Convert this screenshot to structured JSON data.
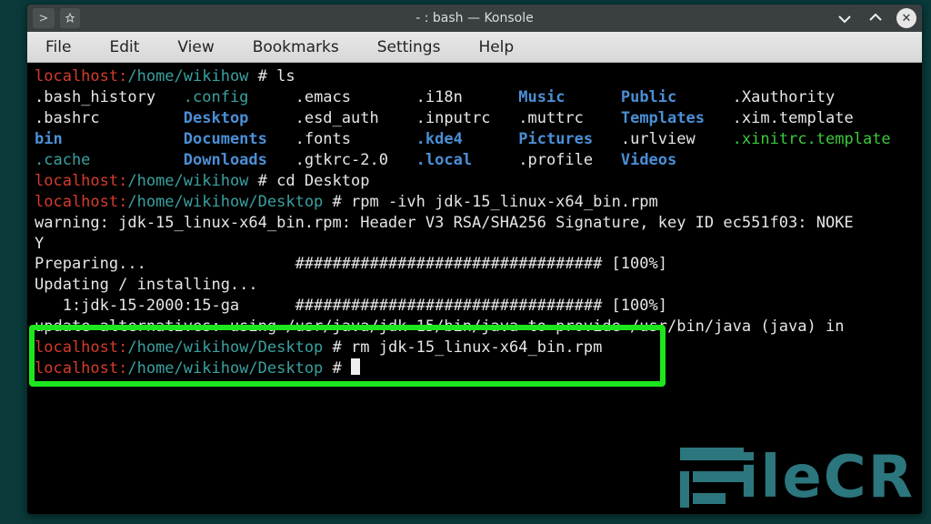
{
  "title": "- : bash — Konsole",
  "menus": {
    "file": "File",
    "edit": "Edit",
    "view": "View",
    "bookmarks": "Bookmarks",
    "settings": "Settings",
    "help": "Help"
  },
  "prompt1": {
    "user": "localhost:",
    "path": "/home/wikihow",
    "hash": " # "
  },
  "prompt2": {
    "user": "localhost:",
    "path": "/home/wikihow/Desktop",
    "hash": " # "
  },
  "cmds": {
    "ls": "ls",
    "cd": "cd Desktop",
    "rpm": "rpm -ivh jdk-15_linux-x64_bin.rpm",
    "rm": "rm jdk-15_linux-x64_bin.rpm"
  },
  "ls_rows": [
    [
      ".bash_history",
      ".config",
      ".emacs",
      ".i18n",
      "Music",
      "Public",
      ".Xauthority"
    ],
    [
      ".bashrc",
      "Desktop",
      ".esd_auth",
      ".inputrc",
      ".muttrc",
      "Templates",
      ".xim.template"
    ],
    [
      "bin",
      "Documents",
      ".fonts",
      ".kde4",
      "Pictures",
      ".urlview",
      ".xinitrc.template"
    ],
    [
      ".cache",
      "Downloads",
      ".gtkrc-2.0",
      ".local",
      ".profile",
      "Videos",
      ""
    ]
  ],
  "ls_classes": [
    [
      "white",
      "cyan",
      "white",
      "white",
      "blue",
      "blue",
      "white"
    ],
    [
      "white",
      "blue",
      "white",
      "white",
      "white",
      "blue",
      "white"
    ],
    [
      "blue",
      "blue",
      "white",
      "blue",
      "blue",
      "white",
      "green"
    ],
    [
      "cyan",
      "blue",
      "white",
      "blue",
      "white",
      "blue",
      "white"
    ]
  ],
  "rpm_out": {
    "warn": "warning: jdk-15_linux-x64_bin.rpm: Header V3 RSA/SHA256 Signature, key ID ec551f03: NOKE\nY",
    "prep_label": "Preparing...",
    "bar": "################################# [100%]",
    "upd": "Updating / installing...",
    "pkg": "   1:jdk-15-2000:15-ga",
    "alt": "update-alternatives: using /usr/java/jdk-15/bin/java to provide /usr/bin/java (java) in"
  },
  "brand_text": "ileCR"
}
